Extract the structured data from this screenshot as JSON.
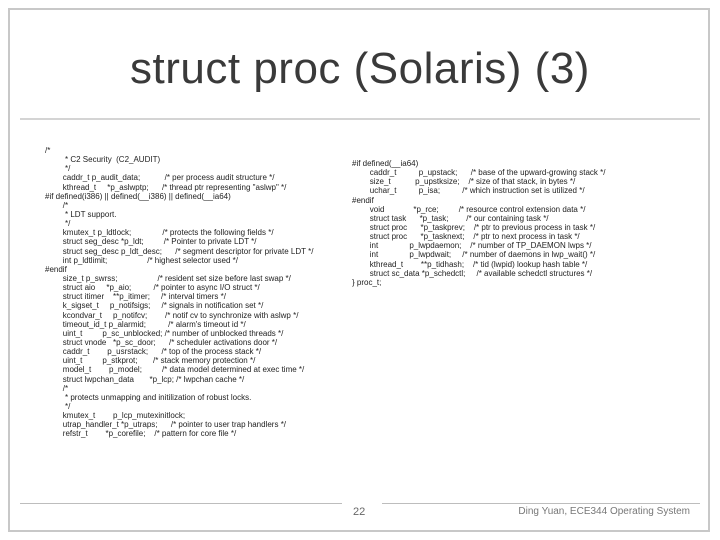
{
  "title": "struct proc (Solaris) (3)",
  "left_code": [
    "/*",
    "         * C2 Security  (C2_AUDIT)",
    "         */",
    "        caddr_t p_audit_data;           /* per process audit structure */",
    "        kthread_t     *p_aslwptp;      /* thread ptr representing \"aslwp\" */",
    "#if defined(i386) || defined(__i386) || defined(__ia64)",
    "        /*",
    "         * LDT support.",
    "         */",
    "        kmutex_t p_ldtlock;              /* protects the following fields */",
    "        struct seg_desc *p_ldt;         /* Pointer to private LDT */",
    "        struct seg_desc p_ldt_desc;      /* segment descriptor for private LDT */",
    "        int p_ldtlimit;                  /* highest selector used */",
    "#endif",
    "        size_t p_swrss;                  /* resident set size before last swap */",
    "        struct aio     *p_aio;          /* pointer to async I/O struct */",
    "        struct itimer    **p_itimer;     /* interval timers */",
    "        k_sigset_t     p_notifsigs;     /* signals in notification set */",
    "        kcondvar_t     p_notifcv;        /* notif cv to synchronize with aslwp */",
    "        timeout_id_t p_alarmid;          /* alarm's timeout id */",
    "        uint_t         p_sc_unblocked; /* number of unblocked threads */",
    "        struct vnode   *p_sc_door;      /* scheduler activations door */",
    "        caddr_t        p_usrstack;      /* top of the process stack */",
    "        uint_t         p_stkprot;       /* stack memory protection */",
    "        model_t        p_model;         /* data model determined at exec time */",
    "        struct lwpchan_data       *p_lcp; /* lwpchan cache */",
    "        /*",
    "         * protects unmapping and initilization of robust locks.",
    "         */",
    "        kmutex_t        p_lcp_mutexinitlock;",
    "        utrap_handler_t *p_utraps;      /* pointer to user trap handlers */",
    "        refstr_t        *p_corefile;    /* pattern for core file */"
  ],
  "right_code": [
    "#if defined(__ia64)",
    "        caddr_t          p_upstack;      /* base of the upward-growing stack */",
    "        size_t           p_upstksize;    /* size of that stack, in bytes */",
    "        uchar_t          p_isa;          /* which instruction set is utilized */",
    "#endif",
    "        void             *p_rce;         /* resource control extension data */",
    "        struct task      *p_task;        /* our containing task */",
    "        struct proc      *p_taskprev;    /* ptr to previous process in task */",
    "        struct proc      *p_tasknext;    /* ptr to next process in task */",
    "        int              p_lwpdaemon;    /* number of TP_DAEMON lwps */",
    "        int              p_lwpdwait;     /* number of daemons in lwp_wait() */",
    "        kthread_t        **p_tidhash;    /* tid (lwpid) lookup hash table */",
    "        struct sc_data *p_schedctl;     /* available schedctl structures */",
    "} proc_t;"
  ],
  "page_number": "22",
  "footer_text": "Ding Yuan, ECE344 Operating System",
  "colors": {
    "border": "#c8c8c8",
    "title": "#3a3a3a",
    "text": "#222222",
    "footer": "#777777"
  }
}
